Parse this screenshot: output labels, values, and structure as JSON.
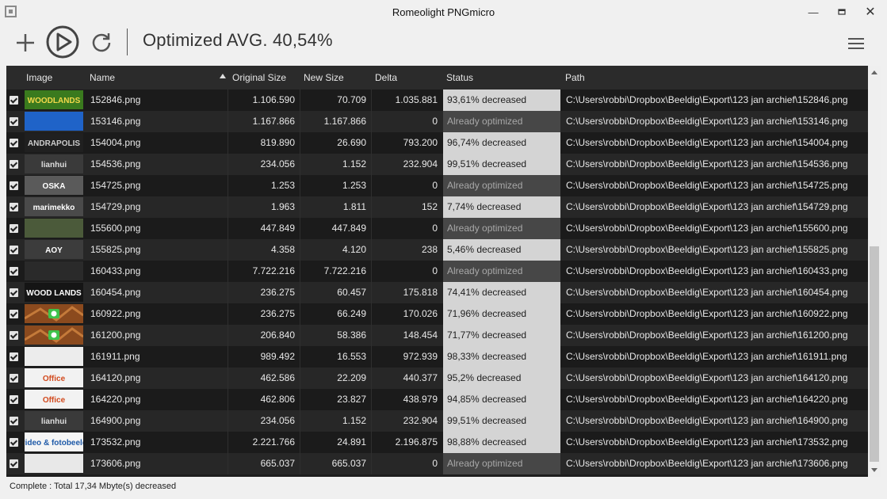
{
  "window": {
    "title": "Romeolight PNGmicro"
  },
  "toolbar": {
    "summary": "Optimized AVG. 40,54%"
  },
  "table": {
    "headers": {
      "image": "Image",
      "name": "Name",
      "original": "Original Size",
      "new": "New Size",
      "delta": "Delta",
      "status": "Status",
      "path": "Path"
    },
    "rows": [
      {
        "name": "152846.png",
        "orig": "1.106.590",
        "new": "70.709",
        "delta": "1.035.881",
        "status": "93,61% decreased",
        "optimized": false,
        "path": "C:\\Users\\robbi\\Dropbox\\Beeldig\\Export\\123 jan archief\\152846.png",
        "thumb": "woodlands-logo"
      },
      {
        "name": "153146.png",
        "orig": "1.167.866",
        "new": "1.167.866",
        "delta": "0",
        "status": "Already optimized",
        "optimized": true,
        "path": "C:\\Users\\robbi\\Dropbox\\Beeldig\\Export\\123 jan archief\\153146.png",
        "thumb": "blue-screenshot"
      },
      {
        "name": "154004.png",
        "orig": "819.890",
        "new": "26.690",
        "delta": "793.200",
        "status": "96,74% decreased",
        "optimized": false,
        "path": "C:\\Users\\robbi\\Dropbox\\Beeldig\\Export\\123 jan archief\\154004.png",
        "thumb": "dark-wordmark"
      },
      {
        "name": "154536.png",
        "orig": "234.056",
        "new": "1.152",
        "delta": "232.904",
        "status": "99,51% decreased",
        "optimized": false,
        "path": "C:\\Users\\robbi\\Dropbox\\Beeldig\\Export\\123 jan archief\\154536.png",
        "thumb": "lianhui-logo"
      },
      {
        "name": "154725.png",
        "orig": "1.253",
        "new": "1.253",
        "delta": "0",
        "status": "Already optimized",
        "optimized": true,
        "path": "C:\\Users\\robbi\\Dropbox\\Beeldig\\Export\\123 jan archief\\154725.png",
        "thumb": "oska-logo"
      },
      {
        "name": "154729.png",
        "orig": "1.963",
        "new": "1.811",
        "delta": "152",
        "status": "7,74% decreased",
        "optimized": false,
        "path": "C:\\Users\\robbi\\Dropbox\\Beeldig\\Export\\123 jan archief\\154729.png",
        "thumb": "marimekko-logo"
      },
      {
        "name": "155600.png",
        "orig": "447.849",
        "new": "447.849",
        "delta": "0",
        "status": "Already optimized",
        "optimized": true,
        "path": "C:\\Users\\robbi\\Dropbox\\Beeldig\\Export\\123 jan archief\\155600.png",
        "thumb": "crowd-photo"
      },
      {
        "name": "155825.png",
        "orig": "4.358",
        "new": "4.120",
        "delta": "238",
        "status": "5,46% decreased",
        "optimized": false,
        "path": "C:\\Users\\robbi\\Dropbox\\Beeldig\\Export\\123 jan archief\\155825.png",
        "thumb": "graffiti-logo"
      },
      {
        "name": "160433.png",
        "orig": "7.722.216",
        "new": "7.722.216",
        "delta": "0",
        "status": "Already optimized",
        "optimized": true,
        "path": "C:\\Users\\robbi\\Dropbox\\Beeldig\\Export\\123 jan archief\\160433.png",
        "thumb": "dark-screenshot"
      },
      {
        "name": "160454.png",
        "orig": "236.275",
        "new": "60.457",
        "delta": "175.818",
        "status": "74,41% decreased",
        "optimized": false,
        "path": "C:\\Users\\robbi\\Dropbox\\Beeldig\\Export\\123 jan archief\\160454.png",
        "thumb": "woodlands-text"
      },
      {
        "name": "160922.png",
        "orig": "236.275",
        "new": "66.249",
        "delta": "170.026",
        "status": "71,96% decreased",
        "optimized": false,
        "path": "C:\\Users\\robbi\\Dropbox\\Beeldig\\Export\\123 jan archief\\160922.png",
        "thumb": "wood-camera"
      },
      {
        "name": "161200.png",
        "orig": "206.840",
        "new": "58.386",
        "delta": "148.454",
        "status": "71,77% decreased",
        "optimized": false,
        "path": "C:\\Users\\robbi\\Dropbox\\Beeldig\\Export\\123 jan archief\\161200.png",
        "thumb": "wood-camera"
      },
      {
        "name": "161911.png",
        "orig": "989.492",
        "new": "16.553",
        "delta": "972.939",
        "status": "98,33% decreased",
        "optimized": false,
        "path": "C:\\Users\\robbi\\Dropbox\\Beeldig\\Export\\123 jan archief\\161911.png",
        "thumb": "light-screenshot"
      },
      {
        "name": "164120.png",
        "orig": "462.586",
        "new": "22.209",
        "delta": "440.377",
        "status": "95,2% decreased",
        "optimized": false,
        "path": "C:\\Users\\robbi\\Dropbox\\Beeldig\\Export\\123 jan archief\\164120.png",
        "thumb": "office-screenshot"
      },
      {
        "name": "164220.png",
        "orig": "462.806",
        "new": "23.827",
        "delta": "438.979",
        "status": "94,85% decreased",
        "optimized": false,
        "path": "C:\\Users\\robbi\\Dropbox\\Beeldig\\Export\\123 jan archief\\164220.png",
        "thumb": "office-screenshot"
      },
      {
        "name": "164900.png",
        "orig": "234.056",
        "new": "1.152",
        "delta": "232.904",
        "status": "99,51% decreased",
        "optimized": false,
        "path": "C:\\Users\\robbi\\Dropbox\\Beeldig\\Export\\123 jan archief\\164900.png",
        "thumb": "lianhui-logo"
      },
      {
        "name": "173532.png",
        "orig": "2.221.766",
        "new": "24.891",
        "delta": "2.196.875",
        "status": "98,88% decreased",
        "optimized": false,
        "path": "C:\\Users\\robbi\\Dropbox\\Beeldig\\Export\\123 jan archief\\173532.png",
        "thumb": "video-banner"
      },
      {
        "name": "173606.png",
        "orig": "665.037",
        "new": "665.037",
        "delta": "0",
        "status": "Already optimized",
        "optimized": true,
        "path": "C:\\Users\\robbi\\Dropbox\\Beeldig\\Export\\123 jan archief\\173606.png",
        "thumb": "web-screenshot"
      }
    ]
  },
  "thumbs": {
    "woodlands-logo": {
      "text": "WOODLANDS",
      "bg": "#3a7a1e",
      "fg": "#f2d84a"
    },
    "blue-screenshot": {
      "text": "",
      "bg": "#1f63c8",
      "fg": "#ffffff"
    },
    "dark-wordmark": {
      "text": "ANDRAPOLIS",
      "bg": "#202020",
      "fg": "#cccccc"
    },
    "lianhui-logo": {
      "text": "lianhui",
      "bg": "#3a3a3a",
      "fg": "#dddddd"
    },
    "oska-logo": {
      "text": "OSKA",
      "bg": "#5a5a5a",
      "fg": "#ffffff"
    },
    "marimekko-logo": {
      "text": "marimekko",
      "bg": "#4a4a4a",
      "fg": "#ffffff"
    },
    "crowd-photo": {
      "text": "",
      "bg": "#4b5a3a",
      "fg": "#ffffff"
    },
    "graffiti-logo": {
      "text": "AOY",
      "bg": "#3c3c3c",
      "fg": "#ffffff"
    },
    "dark-screenshot": {
      "text": "",
      "bg": "#2a2a2a",
      "fg": "#ffffff"
    },
    "woodlands-text": {
      "text": "WOOD LANDS",
      "bg": "#151515",
      "fg": "#ffffff"
    },
    "wood-camera": {
      "text": "",
      "bg": "#8b4a1e",
      "fg": "#3ec24a"
    },
    "light-screenshot": {
      "text": "",
      "bg": "#ececec",
      "fg": "#4a8a3a"
    },
    "office-screenshot": {
      "text": "Office",
      "bg": "#f2f2f2",
      "fg": "#d24a1e"
    },
    "video-banner": {
      "text": "video & fotobeeld",
      "bg": "#f5f5f5",
      "fg": "#1f5aa8"
    },
    "web-screenshot": {
      "text": "",
      "bg": "#e8e8e8",
      "fg": "#2a6ab0"
    }
  },
  "statusbar": {
    "text": "Complete : Total 17,34 Mbyte(s) decreased"
  }
}
